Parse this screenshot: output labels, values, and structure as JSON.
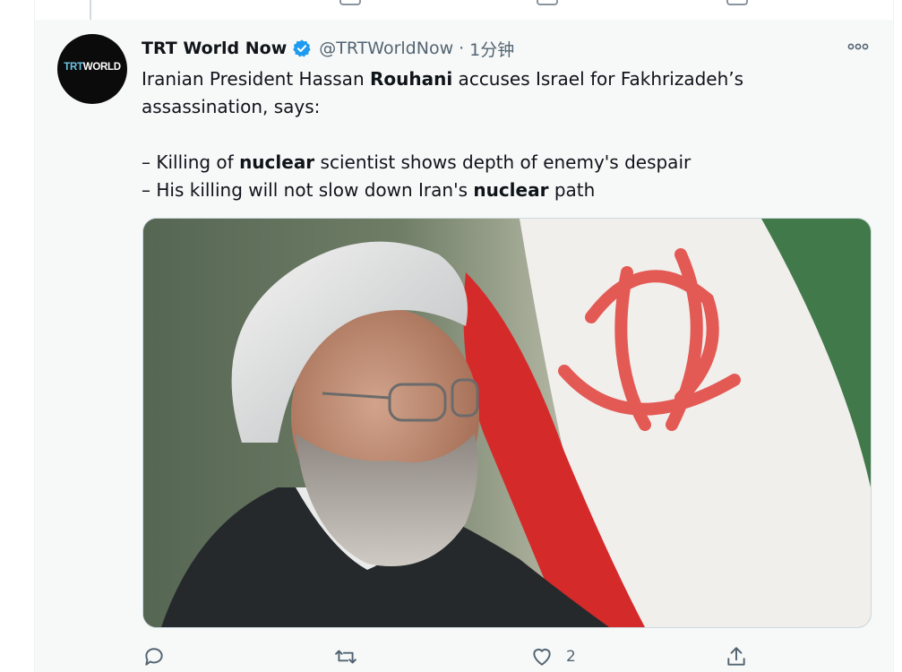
{
  "tweet": {
    "avatar_text_a": "TRT",
    "avatar_text_b": "WORLD",
    "display_name": "TRT World Now",
    "handle": "@TRTWorldNow",
    "separator": "·",
    "time": "1分钟",
    "text": {
      "line1_pre": "Iranian President Hassan ",
      "line1_bold": "Rouhani",
      "line1_post": " accuses Israel for Fakhrizadeh’s",
      "line2": "assassination, says:",
      "line4_pre": "– Killing of ",
      "line4_bold": "nuclear",
      "line4_post": " scientist shows depth of enemy's despair",
      "line5_pre": "– His killing will not slow down Iran's ",
      "line5_bold": "nuclear",
      "line5_post": " path"
    },
    "actions": {
      "reply_count": "",
      "retweet_count": "",
      "like_count": "2",
      "share_count": ""
    }
  },
  "colors": {
    "verified_blue": "#1d9bf0",
    "icon_gray": "#536471",
    "flag_red": "#da0000",
    "flag_green": "#239f40"
  },
  "icons": [
    "verified-badge-icon",
    "more-icon",
    "reply-icon",
    "retweet-icon",
    "like-icon",
    "share-icon"
  ]
}
